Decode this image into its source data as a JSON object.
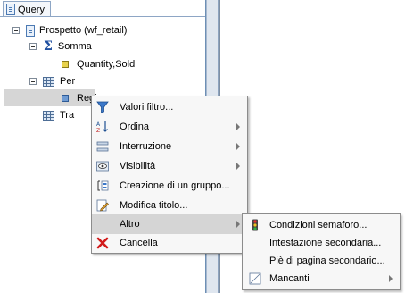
{
  "panel": {
    "tab_label": "Query",
    "tree": {
      "root": "Prospetto (wf_retail)",
      "sum": "Somma",
      "sum_field": "Quantity,Sold",
      "by": "Per",
      "by_field": "Regi",
      "across": "Tra"
    }
  },
  "context_menu": {
    "items": [
      {
        "label": "Valori filtro...",
        "icon": "funnel-icon"
      },
      {
        "label": "Ordina",
        "icon": "sort-az-icon"
      },
      {
        "label": "Interruzione",
        "icon": "break-icon"
      },
      {
        "label": "Visibilità",
        "icon": "eye-icon"
      },
      {
        "label": "Creazione di un gruppo...",
        "icon": "group-icon"
      },
      {
        "label": "Modifica titolo...",
        "icon": "edit-title-icon"
      },
      {
        "label": "Altro",
        "icon": ""
      },
      {
        "label": "Cancella",
        "icon": "delete-icon"
      }
    ]
  },
  "submenu": {
    "items": [
      {
        "label": "Condizioni semaforo...",
        "icon": "traffic-light-icon"
      },
      {
        "label": "Intestazione secondaria...",
        "icon": ""
      },
      {
        "label": "Piè di pagina secondario...",
        "icon": ""
      },
      {
        "label": "Mancanti",
        "icon": "missing-icon"
      }
    ]
  },
  "colors": {
    "highlight": "#d5d5d5",
    "selection_row": "#d6d6d6",
    "delete_red": "#d11a1a",
    "tree_blue": "#1f4fa0"
  }
}
